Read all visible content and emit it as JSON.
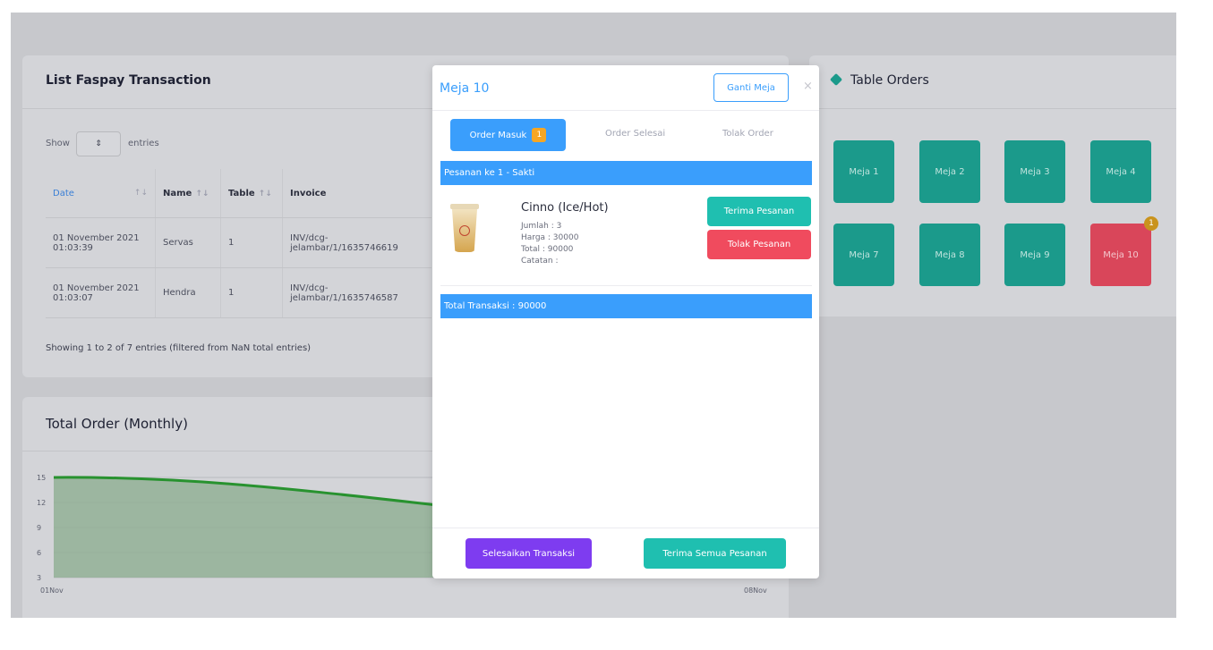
{
  "transactions": {
    "title": "List Faspay Transaction",
    "show_label": "Show",
    "select_icon": "updown-icon",
    "entries_label": "entries",
    "columns": [
      "Date",
      "Name",
      "Table",
      "Invoice"
    ],
    "rows": [
      {
        "date1": "01 November 2021",
        "date2": "01:03:39",
        "name": "Servas",
        "table": "1",
        "inv1": "INV/dcg-",
        "inv2": "jelambar/1/1635746619"
      },
      {
        "date1": "01 November 2021",
        "date2": "01:03:07",
        "name": "Hendra",
        "table": "1",
        "inv1": "INV/dcg-",
        "inv2": "jelambar/1/1635746587"
      }
    ],
    "footer": "Showing 1 to 2 of 7 entries (filtered from NaN total entries)"
  },
  "monthly": {
    "title": "Total Order (Monthly)"
  },
  "chart_data": {
    "type": "area",
    "title": "Total Order (Monthly)",
    "x": [
      "01Nov",
      "08Nov"
    ],
    "y_ticks": [
      3,
      6,
      9,
      12,
      15
    ],
    "ylim": [
      3,
      15
    ],
    "series": [
      {
        "values": [
          15,
          8
        ]
      }
    ],
    "color": "#28922f",
    "grid": true
  },
  "tables": {
    "title": "Table Orders",
    "icon": "cube-icon",
    "tiles": [
      {
        "label": "Meja 1",
        "status": "available"
      },
      {
        "label": "Meja 2",
        "status": "available"
      },
      {
        "label": "Meja 3",
        "status": "available"
      },
      {
        "label": "Meja 4",
        "status": "available"
      },
      {
        "label": "Meja 7",
        "status": "available"
      },
      {
        "label": "Meja 8",
        "status": "available"
      },
      {
        "label": "Meja 9",
        "status": "available"
      },
      {
        "label": "Meja 10",
        "status": "occupied",
        "badge": "1"
      }
    ]
  },
  "modal": {
    "title": "Meja 10",
    "change_table": "Ganti Meja",
    "close_icon": "×",
    "tabs": [
      {
        "label": "Order Masuk",
        "badge": "1",
        "active": true
      },
      {
        "label": "Order Selesai"
      },
      {
        "label": "Tolak Order"
      }
    ],
    "order_header": "Pesanan ke 1 - Sakti",
    "item": {
      "name": "Cinno (Ice/Hot)",
      "qty": "Jumlah : 3",
      "price": "Harga : 30000",
      "total": "Total : 90000",
      "note": "Catatan :"
    },
    "accept_label": "Terima Pesanan",
    "reject_label": "Tolak Pesanan",
    "total_bar": "Total Transaksi : 90000",
    "finish_label": "Selesaikan Transaksi",
    "accept_all_label": "Terima Semua Pesanan"
  },
  "colors": {
    "primary": "#3a9efc",
    "teal": "#1fbfb0",
    "danger": "#f04b5e",
    "purple": "#7e3cf0",
    "badge": "#f5a623"
  }
}
